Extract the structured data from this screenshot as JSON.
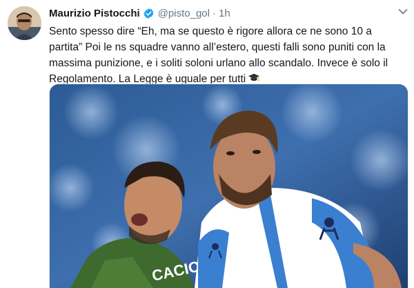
{
  "tweet": {
    "author_name": "Maurizio Pistocchi",
    "handle": "@pisto_gol",
    "separator": "·",
    "time": "1h",
    "text_lines": [
      "Sento spesso dire “Eh, ma se questo è rigore allora ce ne sono 10 a",
      "partita” Poi le ns squadre vanno all’estero, questi falli sono puniti con la",
      "massima punizione, e i soliti soloni urlano allo scandalo. Invece è solo il",
      "Regolamento. La Legge è uguale per tutti"
    ],
    "emoji": "graduation-cap-emoji",
    "verified_icon": "verified-badge-icon",
    "menu_icon": "chevron-down-icon"
  },
  "media": {
    "jersey_text": "CACIORE",
    "brand_mark": "kappa-logo"
  },
  "colors": {
    "text": "#14171a",
    "muted": "#657786",
    "verified": "#1da1f2"
  }
}
